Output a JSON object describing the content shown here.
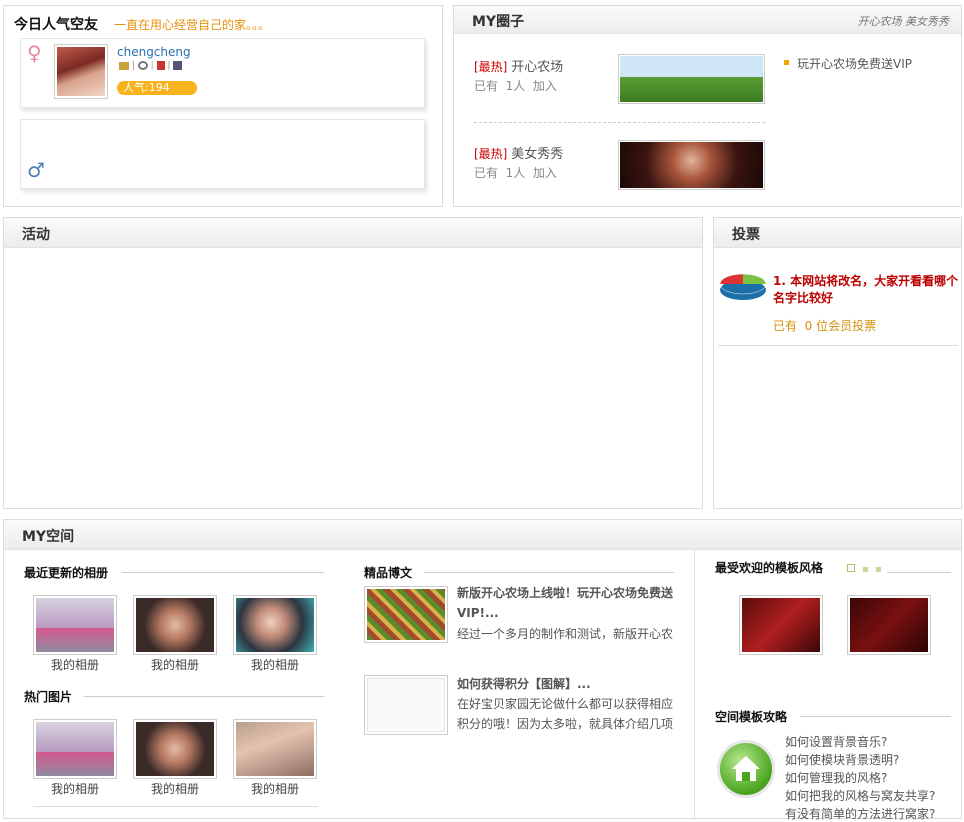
{
  "popular": {
    "title": "今日人气空友",
    "subtitle": "一直在用心经营自己的家。。。",
    "user": {
      "name": "chengcheng",
      "popularity": "人气:194"
    }
  },
  "circles": {
    "title": "MY圈子",
    "links": "开心农场 美女秀秀",
    "items": [
      {
        "tag": "[最热]",
        "name": "开心农场",
        "stats": "已有  1人  加入"
      },
      {
        "tag": "[最热]",
        "name": "美女秀秀",
        "stats": "已有  1人  加入"
      }
    ],
    "side_link": "玩开心农场免费送VIP"
  },
  "activity": {
    "title": "活动"
  },
  "vote": {
    "title": "投票",
    "item": "1. 本网站将改名，大家开看看哪个名字比较好",
    "count": "已有  0 位会员投票"
  },
  "myspace": {
    "title": "MY空间",
    "recent_albums": {
      "title": "最近更新的相册",
      "captions": [
        "我的相册",
        "我的相册",
        "我的相册"
      ]
    },
    "hot_pictures": {
      "title": "热门图片",
      "captions": [
        "我的相册",
        "我的相册",
        "我的相册"
      ]
    },
    "blog": {
      "title": "精品博文",
      "posts": [
        {
          "title": "新版开心农场上线啦！玩开心农场免费送VIP!...",
          "summary": "经过一个多月的制作和测试，新版开心农"
        },
        {
          "title": "如何获得积分【图解】...",
          "summary": "在好宝贝家园无论做什么都可以获得相应积分的哦！因为太多啦，就具体介绍几项"
        }
      ]
    },
    "templates": {
      "title": "最受欢迎的模板风格"
    },
    "guide": {
      "title": "空间模板攻略",
      "items": [
        "如何设置背景音乐?",
        "如何使模块背景透明?",
        "如何管理我的风格?",
        "如何把我的风格与窝友共享?",
        "有没有简单的方法进行窝家?"
      ]
    }
  }
}
